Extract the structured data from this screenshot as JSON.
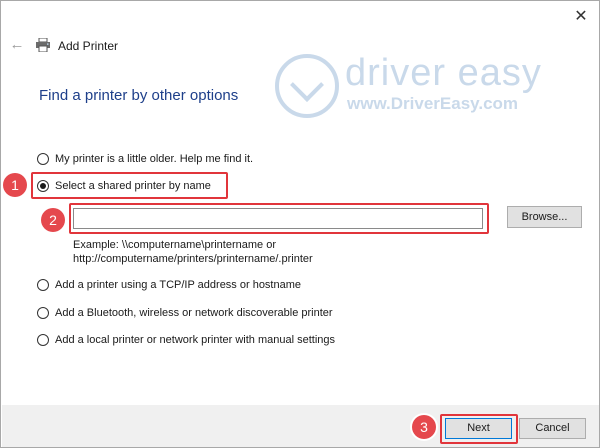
{
  "window": {
    "title": "Add Printer",
    "close_glyph": "✕",
    "back_glyph": "←"
  },
  "watermark": {
    "brand": "driver easy",
    "url": "www.DriverEasy.com"
  },
  "heading": "Find a printer by other options",
  "options": [
    {
      "label": "My printer is a little older. Help me find it.",
      "checked": false
    },
    {
      "label": "Select a shared printer by name",
      "checked": true
    },
    {
      "label": "Add a printer using a TCP/IP address or hostname",
      "checked": false
    },
    {
      "label": "Add a Bluetooth, wireless or network discoverable printer",
      "checked": false
    },
    {
      "label": "Add a local printer or network printer with manual settings",
      "checked": false
    }
  ],
  "shared_printer": {
    "input_value": "",
    "browse_label": "Browse...",
    "example_line1": "Example: \\\\computername\\printername or",
    "example_line2": "http://computername/printers/printername/.printer"
  },
  "badges": {
    "step1": "1",
    "step2": "2",
    "step3": "3"
  },
  "footer": {
    "next_label": "Next",
    "cancel_label": "Cancel"
  },
  "colors": {
    "heading": "#1e3f8a",
    "annotation_red": "#e1353b",
    "watermark": "#c9d9ea",
    "footer_bg": "#f0f0f0"
  },
  "icons": [
    "close-icon",
    "back-arrow-icon",
    "printer-icon",
    "driver-easy-logo"
  ]
}
